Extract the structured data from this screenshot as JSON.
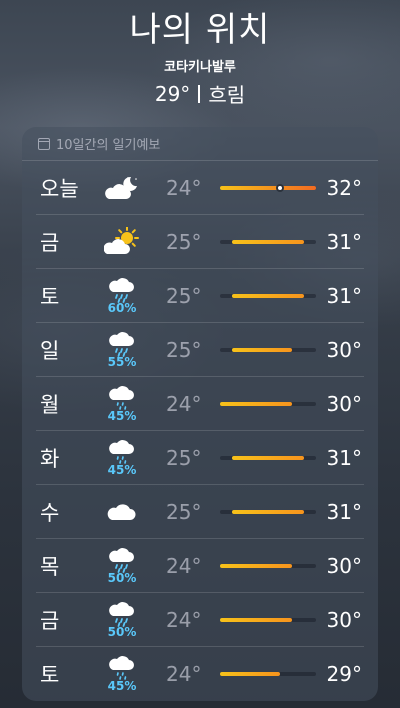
{
  "header": {
    "location_title": "나의 위치",
    "place_name": "코타키나발루",
    "current_temp": "29°",
    "current_condition": "흐림"
  },
  "forecast": {
    "heading": "10일간의 일기예보",
    "range_min": 24,
    "range_max": 32,
    "current_temp_value": 29,
    "days": [
      {
        "day": "오늘",
        "icon": "cloud-moon-icon",
        "precip": "",
        "low": "24°",
        "high": "32°",
        "low_value": 24,
        "high_value": 32
      },
      {
        "day": "금",
        "icon": "cloud-sun-icon",
        "precip": "",
        "low": "25°",
        "high": "31°",
        "low_value": 25,
        "high_value": 31
      },
      {
        "day": "토",
        "icon": "cloud-rain-icon",
        "precip": "60%",
        "low": "25°",
        "high": "31°",
        "low_value": 25,
        "high_value": 31
      },
      {
        "day": "일",
        "icon": "cloud-rain-icon",
        "precip": "55%",
        "low": "25°",
        "high": "30°",
        "low_value": 25,
        "high_value": 30
      },
      {
        "day": "월",
        "icon": "cloud-drizzle-icon",
        "precip": "45%",
        "low": "24°",
        "high": "30°",
        "low_value": 24,
        "high_value": 30
      },
      {
        "day": "화",
        "icon": "cloud-drizzle-icon",
        "precip": "45%",
        "low": "25°",
        "high": "31°",
        "low_value": 25,
        "high_value": 31
      },
      {
        "day": "수",
        "icon": "cloud-icon",
        "precip": "",
        "low": "25°",
        "high": "31°",
        "low_value": 25,
        "high_value": 31
      },
      {
        "day": "목",
        "icon": "cloud-rain-icon",
        "precip": "50%",
        "low": "24°",
        "high": "30°",
        "low_value": 24,
        "high_value": 30
      },
      {
        "day": "금",
        "icon": "cloud-rain-icon",
        "precip": "50%",
        "low": "24°",
        "high": "30°",
        "low_value": 24,
        "high_value": 30
      },
      {
        "day": "토",
        "icon": "cloud-drizzle-icon",
        "precip": "45%",
        "low": "24°",
        "high": "29°",
        "low_value": 24,
        "high_value": 29
      }
    ]
  },
  "colors": {
    "precip_text": "#5ac8fa",
    "bar_yellow": "#f7c21a",
    "bar_orange": "#f7941d",
    "bar_deep_orange": "#f26b21"
  }
}
